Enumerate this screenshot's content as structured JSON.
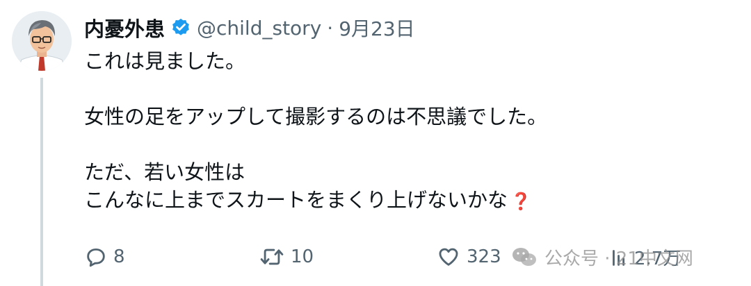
{
  "tweet": {
    "author": {
      "display_name": "内憂外患",
      "handle": "@child_story",
      "verified": true,
      "avatar_icon": "anime-man-glasses-avatar-icon"
    },
    "separator": "·",
    "date": "9月23日",
    "text_lines": [
      "これは見ました。",
      "",
      "女性の足をアップして撮影するのは不思議でした。",
      "",
      "ただ、若い女性は",
      "こんなに上までスカートをまくり上げないかな"
    ],
    "emoji_suffix": "❓"
  },
  "actions": {
    "reply": {
      "icon": "reply-icon",
      "count": "8"
    },
    "retweet": {
      "icon": "retweet-icon",
      "count": "10"
    },
    "like": {
      "icon": "heart-icon",
      "count": "323"
    },
    "views": {
      "icon": "views-icon",
      "count": "2.7万"
    }
  },
  "watermark": {
    "icon": "wechat-icon",
    "text": "公众号 · 21中文网"
  },
  "colors": {
    "text": "#0f1419",
    "muted": "#536471",
    "verified_blue": "#1d9bf0",
    "thread_line": "#cfd9de"
  }
}
